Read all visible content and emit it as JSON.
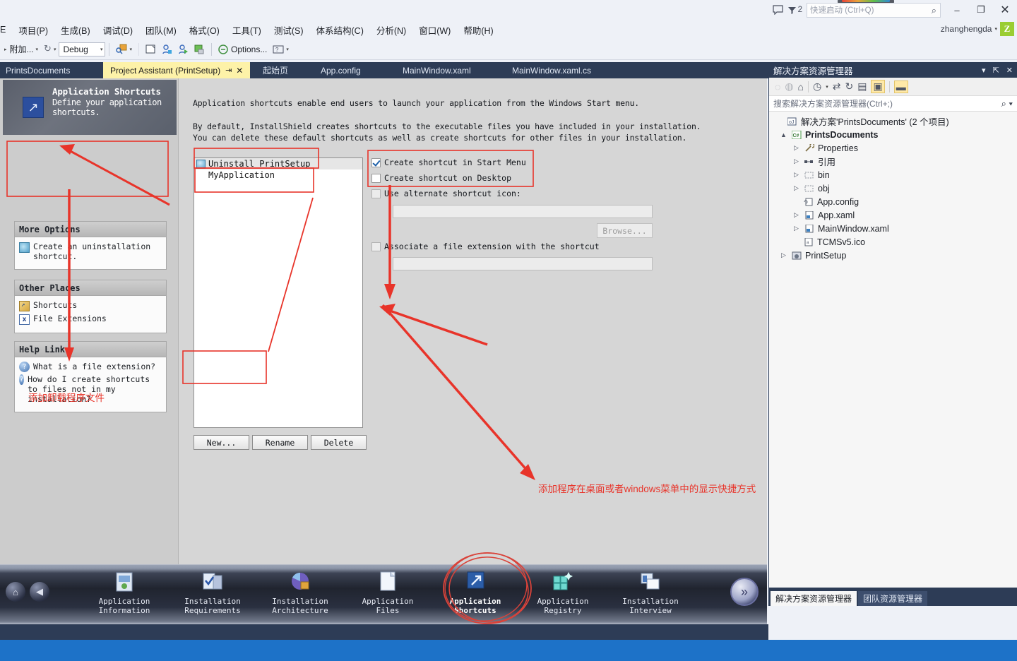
{
  "titlebar": {
    "quick_launch_placeholder": "快速启动 (Ctrl+Q)",
    "notification_count": "2",
    "user_name": "zhanghengda",
    "avatar_letter": "Z",
    "minimize": "–",
    "maximize": "❐",
    "close": "✕"
  },
  "menubar": {
    "items": [
      "E",
      "项目(P)",
      "生成(B)",
      "调试(D)",
      "团队(M)",
      "格式(O)",
      "工具(T)",
      "测试(S)",
      "体系结构(C)",
      "分析(N)",
      "窗口(W)",
      "帮助(H)"
    ]
  },
  "toolbar": {
    "attach_label": "附加...",
    "config_value": "Debug",
    "options_label": "Options..."
  },
  "doc_tabs": {
    "left_label": "PrintsDocuments",
    "items": [
      {
        "label": "Project Assistant (PrintSetup)",
        "active": true,
        "pin": "⇥",
        "close": "✕"
      },
      {
        "label": "起始页",
        "active": false
      },
      {
        "label": "App.config",
        "active": false
      },
      {
        "label": "MainWindow.xaml",
        "active": false
      },
      {
        "label": "MainWindow.xaml.cs",
        "active": false
      }
    ]
  },
  "project_assistant": {
    "header": {
      "title": "Application Shortcuts",
      "subtitle": "Define your application shortcuts.",
      "icon": "shortcut-arrow-icon"
    },
    "more_options": {
      "header": "More Options",
      "links": [
        {
          "label": "Create an uninstallation shortcut.",
          "icon": "uninstall-icon"
        }
      ]
    },
    "other_places": {
      "header": "Other Places",
      "links": [
        {
          "label": "Shortcuts",
          "icon": "shortcut-folder-icon"
        },
        {
          "label": "File Extensions",
          "icon": "file-extension-icon"
        }
      ]
    },
    "help_links": {
      "header": "Help Links",
      "links": [
        {
          "label": "What is a file extension?",
          "icon": "help-icon"
        },
        {
          "label": "How do I create shortcuts to files not in my installation?",
          "icon": "help-icon"
        }
      ]
    },
    "paragraph1": "Application shortcuts enable end users to launch your application from the Windows Start menu.",
    "paragraph2_line1": "By default, InstallShield creates shortcuts to the executable files you have included in your installation.",
    "paragraph2_line2": "You can delete these default shortcuts as well as create shortcuts for other files in your installation.",
    "shortcut_list": [
      {
        "label": "Uninstall PrintSetup",
        "selected": true,
        "icon": "uninstall-icon"
      },
      {
        "label": "MyApplication",
        "selected": false,
        "icon": ""
      }
    ],
    "buttons": {
      "new": "New...",
      "rename": "Rename",
      "delete": "Delete"
    },
    "checkboxes": [
      {
        "label": "Create shortcut in Start Menu",
        "checked": true,
        "enabled": true
      },
      {
        "label": "Create shortcut on Desktop",
        "checked": false,
        "enabled": true
      },
      {
        "label": "Use alternate shortcut icon:",
        "checked": false,
        "enabled": false
      },
      {
        "label": "Associate a file extension with the shortcut",
        "checked": false,
        "enabled": false
      }
    ],
    "browse_button": "Browse...",
    "icon_field_value": "",
    "extension_field_value": ""
  },
  "nav_bar": {
    "home_icon": "home-icon",
    "back_icon": "back-arrow-icon",
    "next_icon": "next-arrow-icon",
    "items": [
      {
        "line1": "Application",
        "line2": "Information",
        "icon": "app-information-icon",
        "current": false
      },
      {
        "line1": "Installation",
        "line2": "Requirements",
        "icon": "installation-requirements-icon",
        "current": false
      },
      {
        "line1": "Installation",
        "line2": "Architecture",
        "icon": "installation-architecture-icon",
        "current": false
      },
      {
        "line1": "Application",
        "line2": "Files",
        "icon": "application-files-icon",
        "current": false
      },
      {
        "line1": "Application",
        "line2": "Shortcuts",
        "icon": "application-shortcuts-icon",
        "current": true
      },
      {
        "line1": "Application",
        "line2": "Registry",
        "icon": "application-registry-icon",
        "current": false
      },
      {
        "line1": "Installation",
        "line2": "Interview",
        "icon": "installation-interview-icon",
        "current": false
      }
    ]
  },
  "solution_explorer": {
    "title": "解决方案资源管理器",
    "search_placeholder": "搜索解决方案资源管理器(Ctrl+;)",
    "tree": [
      {
        "label": "解决方案'PrintsDocuments' (2 个项目)",
        "indent": 0,
        "twisty": "",
        "icon": "solution-icon",
        "bold": false
      },
      {
        "label": "PrintsDocuments",
        "indent": 1,
        "twisty": "▲",
        "icon": "csharp-project-icon",
        "bold": true
      },
      {
        "label": "Properties",
        "indent": 2,
        "twisty": "▷",
        "icon": "wrench-icon",
        "bold": false
      },
      {
        "label": "引用",
        "indent": 2,
        "twisty": "▷",
        "icon": "references-icon",
        "bold": false
      },
      {
        "label": "bin",
        "indent": 2,
        "twisty": "▷",
        "icon": "folder-icon",
        "bold": false
      },
      {
        "label": "obj",
        "indent": 2,
        "twisty": "▷",
        "icon": "folder-icon",
        "bold": false
      },
      {
        "label": "App.config",
        "indent": 3,
        "twisty": "",
        "icon": "config-file-icon",
        "bold": false
      },
      {
        "label": "App.xaml",
        "indent": 2,
        "twisty": "▷",
        "icon": "xaml-file-icon",
        "bold": false
      },
      {
        "label": "MainWindow.xaml",
        "indent": 2,
        "twisty": "▷",
        "icon": "xaml-file-icon",
        "bold": false
      },
      {
        "label": "TCMSv5.ico",
        "indent": 3,
        "twisty": "",
        "icon": "ico-file-icon",
        "bold": false
      },
      {
        "label": "PrintSetup",
        "indent": 1,
        "twisty": "▷",
        "icon": "setup-project-icon",
        "bold": false
      }
    ],
    "bottom_tabs": [
      {
        "label": "解决方案资源管理器",
        "active": true
      },
      {
        "label": "团队资源管理器",
        "active": false
      }
    ]
  },
  "annotations": {
    "note_left": "添加卸载程序文件",
    "note_bottom": "添加程序在桌面或者windows菜单中的显示快捷方式",
    "color": "#e8342a"
  }
}
